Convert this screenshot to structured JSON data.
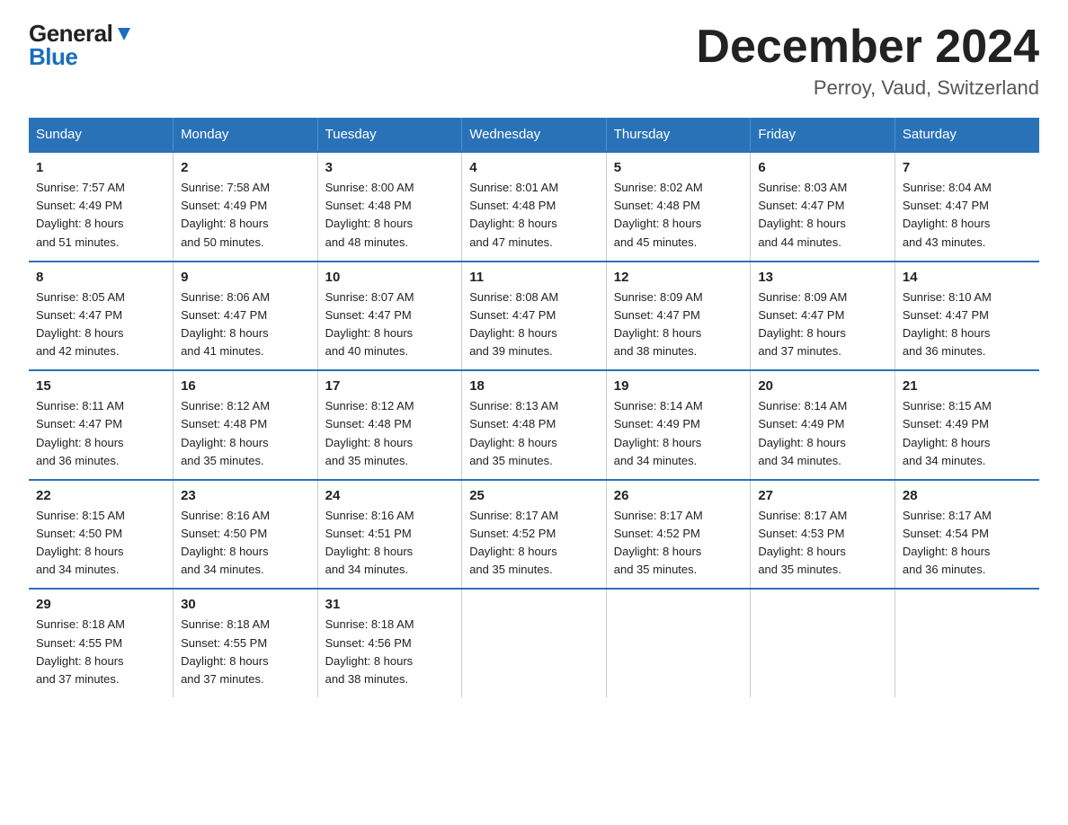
{
  "header": {
    "logo_general": "General",
    "logo_blue": "Blue",
    "title": "December 2024",
    "subtitle": "Perroy, Vaud, Switzerland"
  },
  "columns": [
    "Sunday",
    "Monday",
    "Tuesday",
    "Wednesday",
    "Thursday",
    "Friday",
    "Saturday"
  ],
  "weeks": [
    [
      {
        "day": "1",
        "sunrise": "7:57 AM",
        "sunset": "4:49 PM",
        "daylight": "8 hours and 51 minutes."
      },
      {
        "day": "2",
        "sunrise": "7:58 AM",
        "sunset": "4:49 PM",
        "daylight": "8 hours and 50 minutes."
      },
      {
        "day": "3",
        "sunrise": "8:00 AM",
        "sunset": "4:48 PM",
        "daylight": "8 hours and 48 minutes."
      },
      {
        "day": "4",
        "sunrise": "8:01 AM",
        "sunset": "4:48 PM",
        "daylight": "8 hours and 47 minutes."
      },
      {
        "day": "5",
        "sunrise": "8:02 AM",
        "sunset": "4:48 PM",
        "daylight": "8 hours and 45 minutes."
      },
      {
        "day": "6",
        "sunrise": "8:03 AM",
        "sunset": "4:47 PM",
        "daylight": "8 hours and 44 minutes."
      },
      {
        "day": "7",
        "sunrise": "8:04 AM",
        "sunset": "4:47 PM",
        "daylight": "8 hours and 43 minutes."
      }
    ],
    [
      {
        "day": "8",
        "sunrise": "8:05 AM",
        "sunset": "4:47 PM",
        "daylight": "8 hours and 42 minutes."
      },
      {
        "day": "9",
        "sunrise": "8:06 AM",
        "sunset": "4:47 PM",
        "daylight": "8 hours and 41 minutes."
      },
      {
        "day": "10",
        "sunrise": "8:07 AM",
        "sunset": "4:47 PM",
        "daylight": "8 hours and 40 minutes."
      },
      {
        "day": "11",
        "sunrise": "8:08 AM",
        "sunset": "4:47 PM",
        "daylight": "8 hours and 39 minutes."
      },
      {
        "day": "12",
        "sunrise": "8:09 AM",
        "sunset": "4:47 PM",
        "daylight": "8 hours and 38 minutes."
      },
      {
        "day": "13",
        "sunrise": "8:09 AM",
        "sunset": "4:47 PM",
        "daylight": "8 hours and 37 minutes."
      },
      {
        "day": "14",
        "sunrise": "8:10 AM",
        "sunset": "4:47 PM",
        "daylight": "8 hours and 36 minutes."
      }
    ],
    [
      {
        "day": "15",
        "sunrise": "8:11 AM",
        "sunset": "4:47 PM",
        "daylight": "8 hours and 36 minutes."
      },
      {
        "day": "16",
        "sunrise": "8:12 AM",
        "sunset": "4:48 PM",
        "daylight": "8 hours and 35 minutes."
      },
      {
        "day": "17",
        "sunrise": "8:12 AM",
        "sunset": "4:48 PM",
        "daylight": "8 hours and 35 minutes."
      },
      {
        "day": "18",
        "sunrise": "8:13 AM",
        "sunset": "4:48 PM",
        "daylight": "8 hours and 35 minutes."
      },
      {
        "day": "19",
        "sunrise": "8:14 AM",
        "sunset": "4:49 PM",
        "daylight": "8 hours and 34 minutes."
      },
      {
        "day": "20",
        "sunrise": "8:14 AM",
        "sunset": "4:49 PM",
        "daylight": "8 hours and 34 minutes."
      },
      {
        "day": "21",
        "sunrise": "8:15 AM",
        "sunset": "4:49 PM",
        "daylight": "8 hours and 34 minutes."
      }
    ],
    [
      {
        "day": "22",
        "sunrise": "8:15 AM",
        "sunset": "4:50 PM",
        "daylight": "8 hours and 34 minutes."
      },
      {
        "day": "23",
        "sunrise": "8:16 AM",
        "sunset": "4:50 PM",
        "daylight": "8 hours and 34 minutes."
      },
      {
        "day": "24",
        "sunrise": "8:16 AM",
        "sunset": "4:51 PM",
        "daylight": "8 hours and 34 minutes."
      },
      {
        "day": "25",
        "sunrise": "8:17 AM",
        "sunset": "4:52 PM",
        "daylight": "8 hours and 35 minutes."
      },
      {
        "day": "26",
        "sunrise": "8:17 AM",
        "sunset": "4:52 PM",
        "daylight": "8 hours and 35 minutes."
      },
      {
        "day": "27",
        "sunrise": "8:17 AM",
        "sunset": "4:53 PM",
        "daylight": "8 hours and 35 minutes."
      },
      {
        "day": "28",
        "sunrise": "8:17 AM",
        "sunset": "4:54 PM",
        "daylight": "8 hours and 36 minutes."
      }
    ],
    [
      {
        "day": "29",
        "sunrise": "8:18 AM",
        "sunset": "4:55 PM",
        "daylight": "8 hours and 37 minutes."
      },
      {
        "day": "30",
        "sunrise": "8:18 AM",
        "sunset": "4:55 PM",
        "daylight": "8 hours and 37 minutes."
      },
      {
        "day": "31",
        "sunrise": "8:18 AM",
        "sunset": "4:56 PM",
        "daylight": "8 hours and 38 minutes."
      },
      null,
      null,
      null,
      null
    ]
  ],
  "labels": {
    "sunrise": "Sunrise:",
    "sunset": "Sunset:",
    "daylight": "Daylight:"
  }
}
